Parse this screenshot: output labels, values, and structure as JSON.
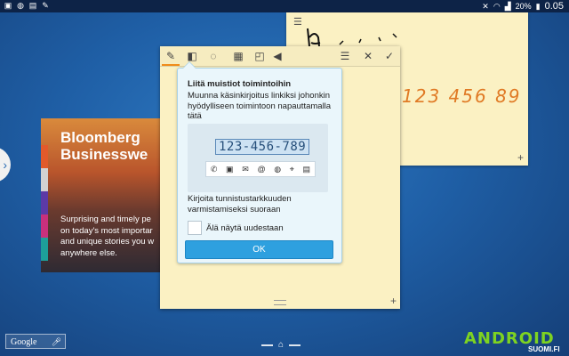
{
  "status_bar": {
    "battery_percent": "20%",
    "time": "0.05"
  },
  "bloomberg_card": {
    "title_line1": "Bloomberg",
    "title_line2": "Businesswe",
    "body_line1": "Surprising and timely pe",
    "body_line2": "on today's most importar",
    "body_line3": "and unique stories you w",
    "body_line4": "anywhere else."
  },
  "note_back": {
    "handwriting_black": "h . i . i",
    "handwriting_orange": "123 456 89"
  },
  "popup": {
    "title": "Liitä muistiot toimintoihin",
    "description": "Muunna käsinkirjoitus linkiksi johonkin hyödylliseen toimintoon napauttamalla tätä",
    "demo_number": "123-456-789",
    "message": "Kirjoita tunnistustarkkuuden varmistamiseksi suoraan",
    "checkbox_label": "Älä näytä uudestaan",
    "ok_button": "OK"
  },
  "bottom": {
    "search_label": "Google",
    "watermark_logo": "ANDROID",
    "watermark_sub": "SUOMI.FI"
  },
  "colors": {
    "accent_orange": "#f08c1a",
    "note_yellow": "#fbf1c3",
    "ok_button_blue": "#2ea0df",
    "popup_bg": "#eaf6fb",
    "logo_green": "#7ed321"
  }
}
